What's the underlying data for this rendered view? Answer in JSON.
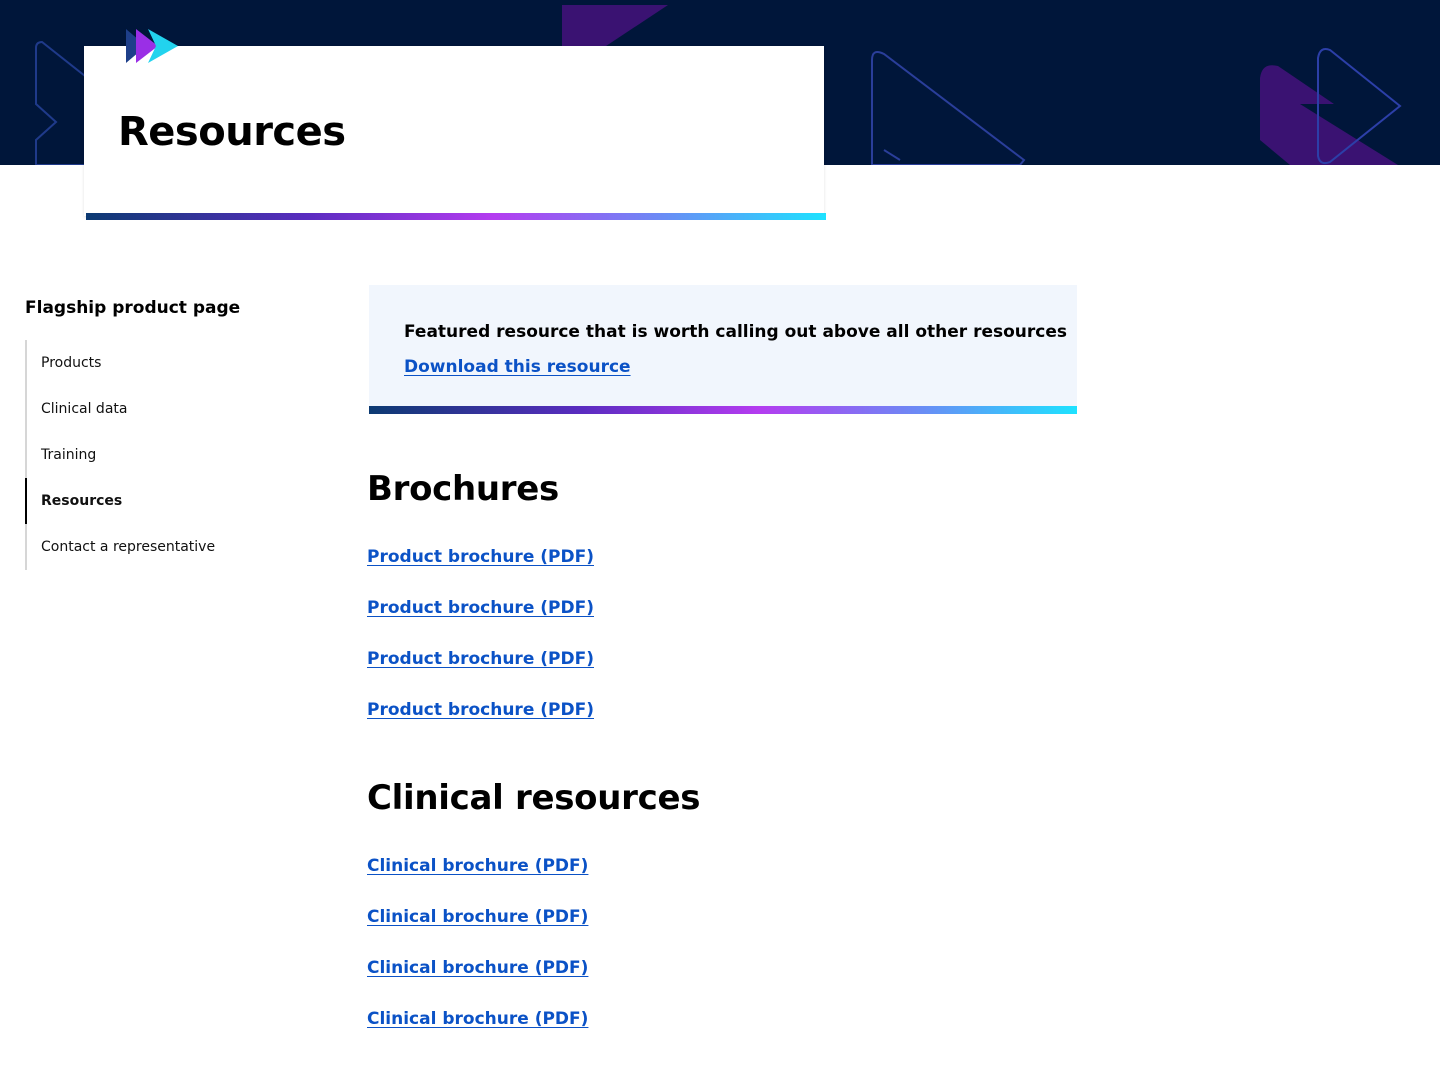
{
  "header": {
    "title": "Resources",
    "logo_icon": "triple-chevron-logo-icon"
  },
  "sidenav": {
    "title": "Flagship product page",
    "items": [
      {
        "label": "Products",
        "active": false
      },
      {
        "label": "Clinical data",
        "active": false
      },
      {
        "label": "Training",
        "active": false
      },
      {
        "label": "Resources",
        "active": true
      },
      {
        "label": "Contact a representative",
        "active": false
      }
    ]
  },
  "featured": {
    "text": "Featured resource that is worth calling out above all other resources",
    "link_label": "Download this resource"
  },
  "brochures": {
    "heading": "Brochures",
    "links": [
      "Product brochure (PDF)",
      "Product brochure (PDF)",
      "Product brochure (PDF)",
      "Product brochure (PDF)"
    ]
  },
  "clinical": {
    "heading": "Clinical resources",
    "links": [
      "Clinical brochure (PDF)",
      "Clinical brochure (PDF)",
      "Clinical brochure (PDF)",
      "Clinical brochure (PDF)"
    ]
  },
  "colors": {
    "hero_bg": "#00163a",
    "link": "#0b52c6",
    "featured_bg": "#f1f6fd",
    "accent_purple": "#3a1272"
  }
}
